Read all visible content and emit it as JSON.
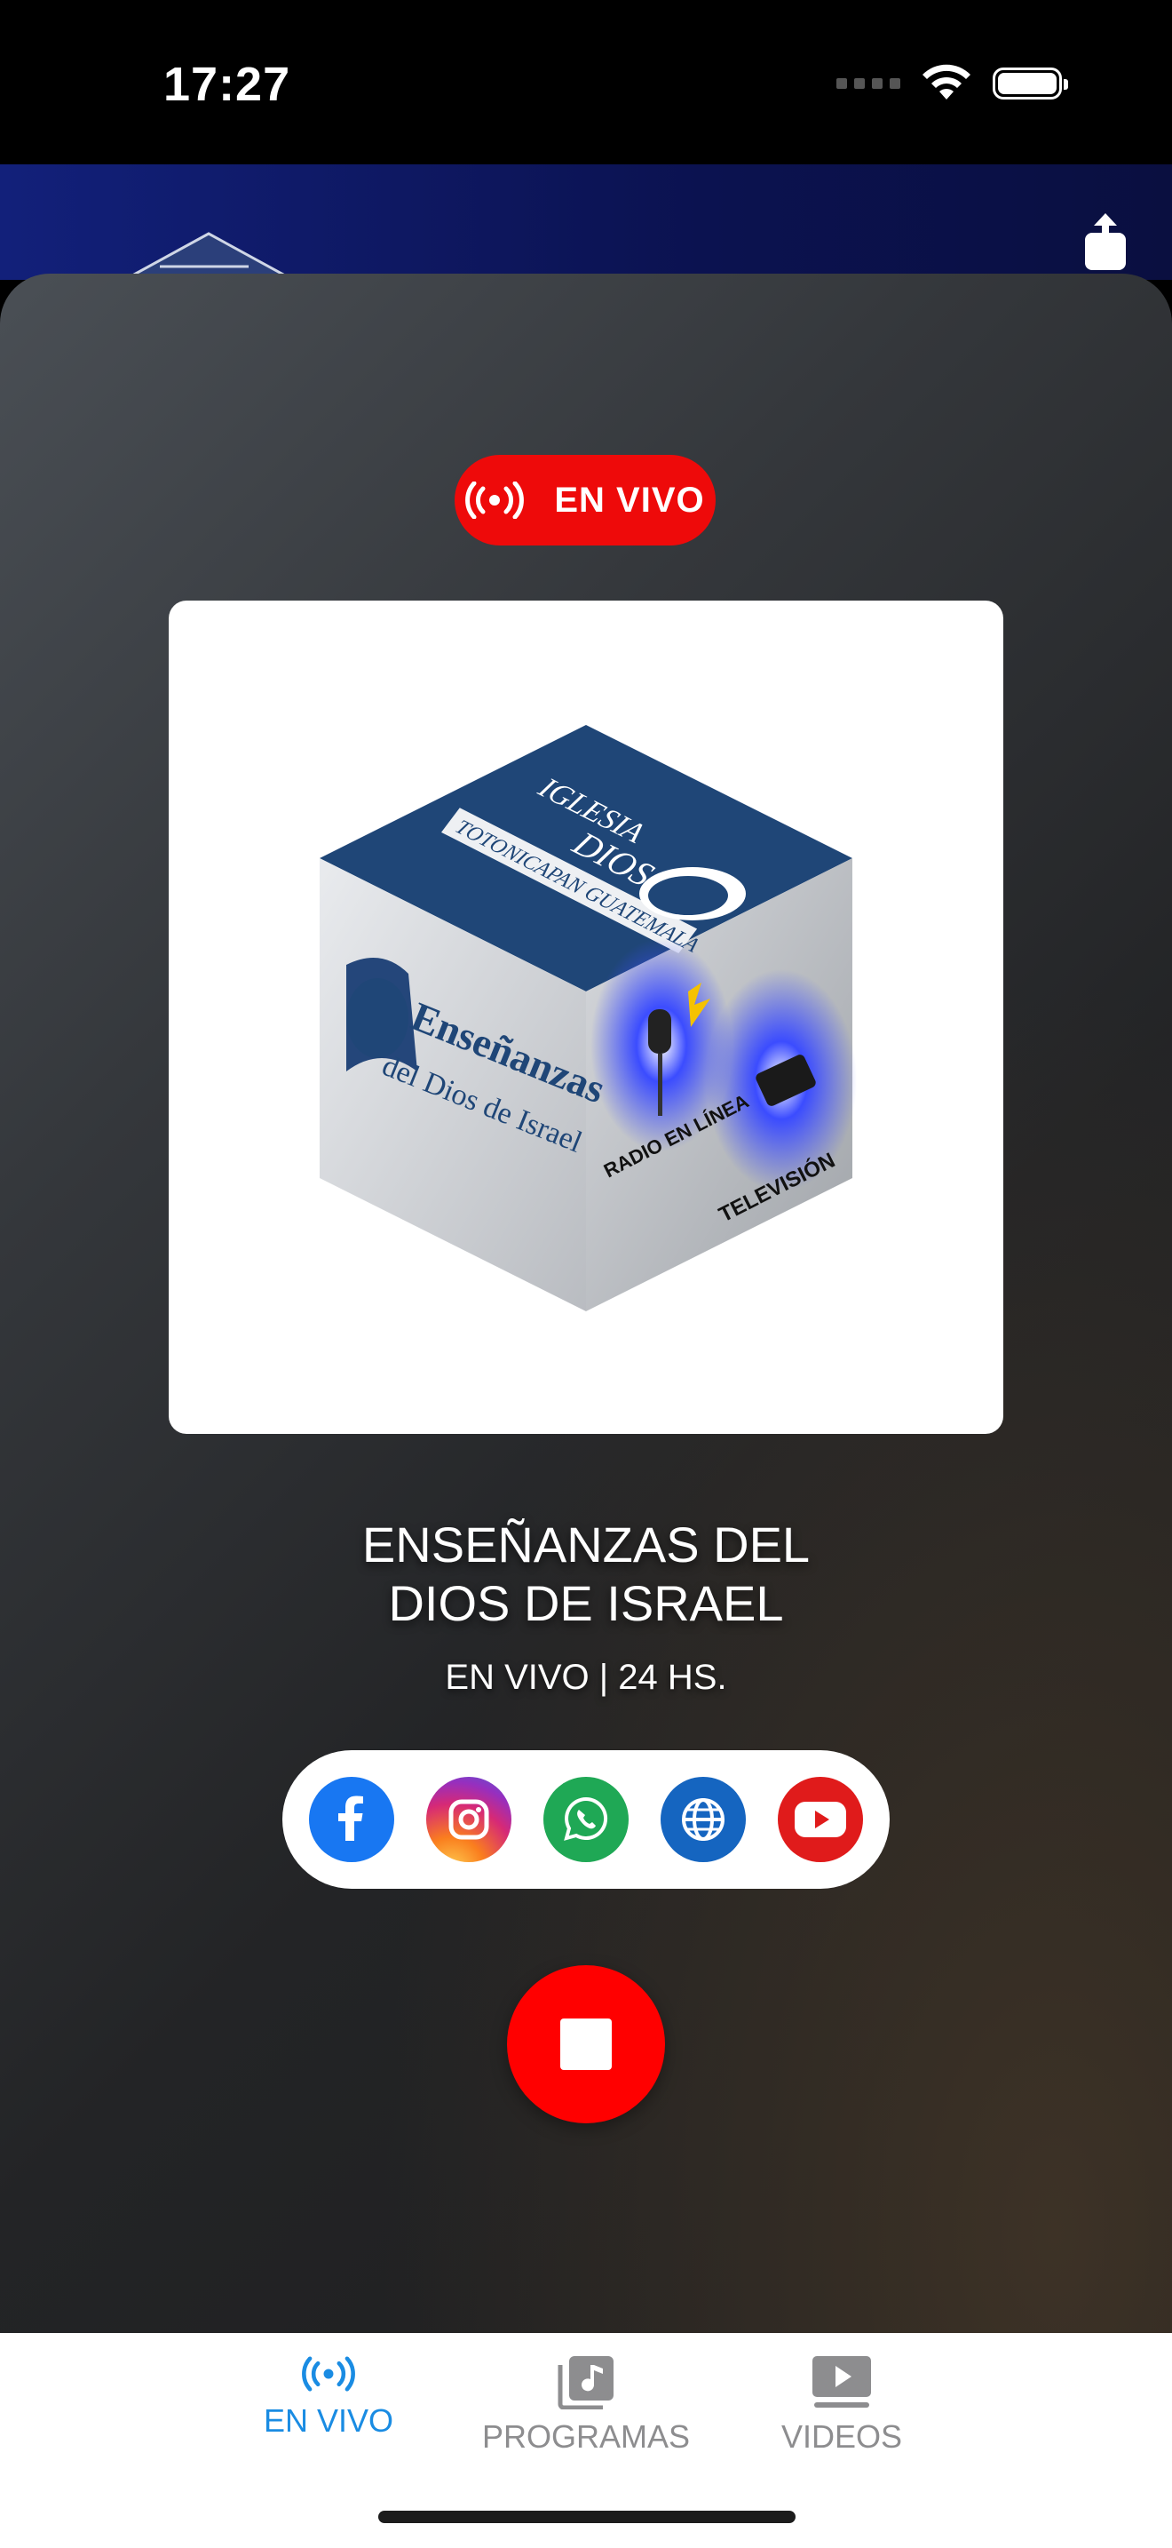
{
  "status_bar": {
    "time": "17:27",
    "icons": [
      "signal-icon",
      "wifi-icon",
      "battery-icon"
    ]
  },
  "header": {
    "share_icon": "share-icon"
  },
  "player": {
    "live_badge": "EN VIVO",
    "artwork": {
      "top_text_1": "IGLESIA",
      "top_text_2": "DIOS",
      "top_text_3": "TOTONICAPAN GUATEMALA",
      "left_text_1": "Enseñanzas",
      "left_text_2": "del Dios de Israel",
      "right_text_1": "RADIO EN LÍNEA",
      "right_text_2": "TELEVISIÓN"
    },
    "title_line1": "ENSEÑANZAS DEL",
    "title_line2": "DIOS DE ISRAEL",
    "subtitle": "EN VIVO | 24 HS.",
    "social": [
      "facebook-icon",
      "instagram-icon",
      "whatsapp-icon",
      "globe-icon",
      "youtube-icon"
    ],
    "brand_colors": {
      "live": "#ee0a0a",
      "stop": "#ff0000",
      "tab_active": "#1a8ce3",
      "tab_inactive": "#8d8d8f"
    }
  },
  "tabs": [
    {
      "label": "EN VIVO",
      "icon": "broadcast-icon",
      "active": true
    },
    {
      "label": "PROGRAMAS",
      "icon": "music-library-icon",
      "active": false
    },
    {
      "label": "VIDEOS",
      "icon": "play-video-icon",
      "active": false
    }
  ]
}
